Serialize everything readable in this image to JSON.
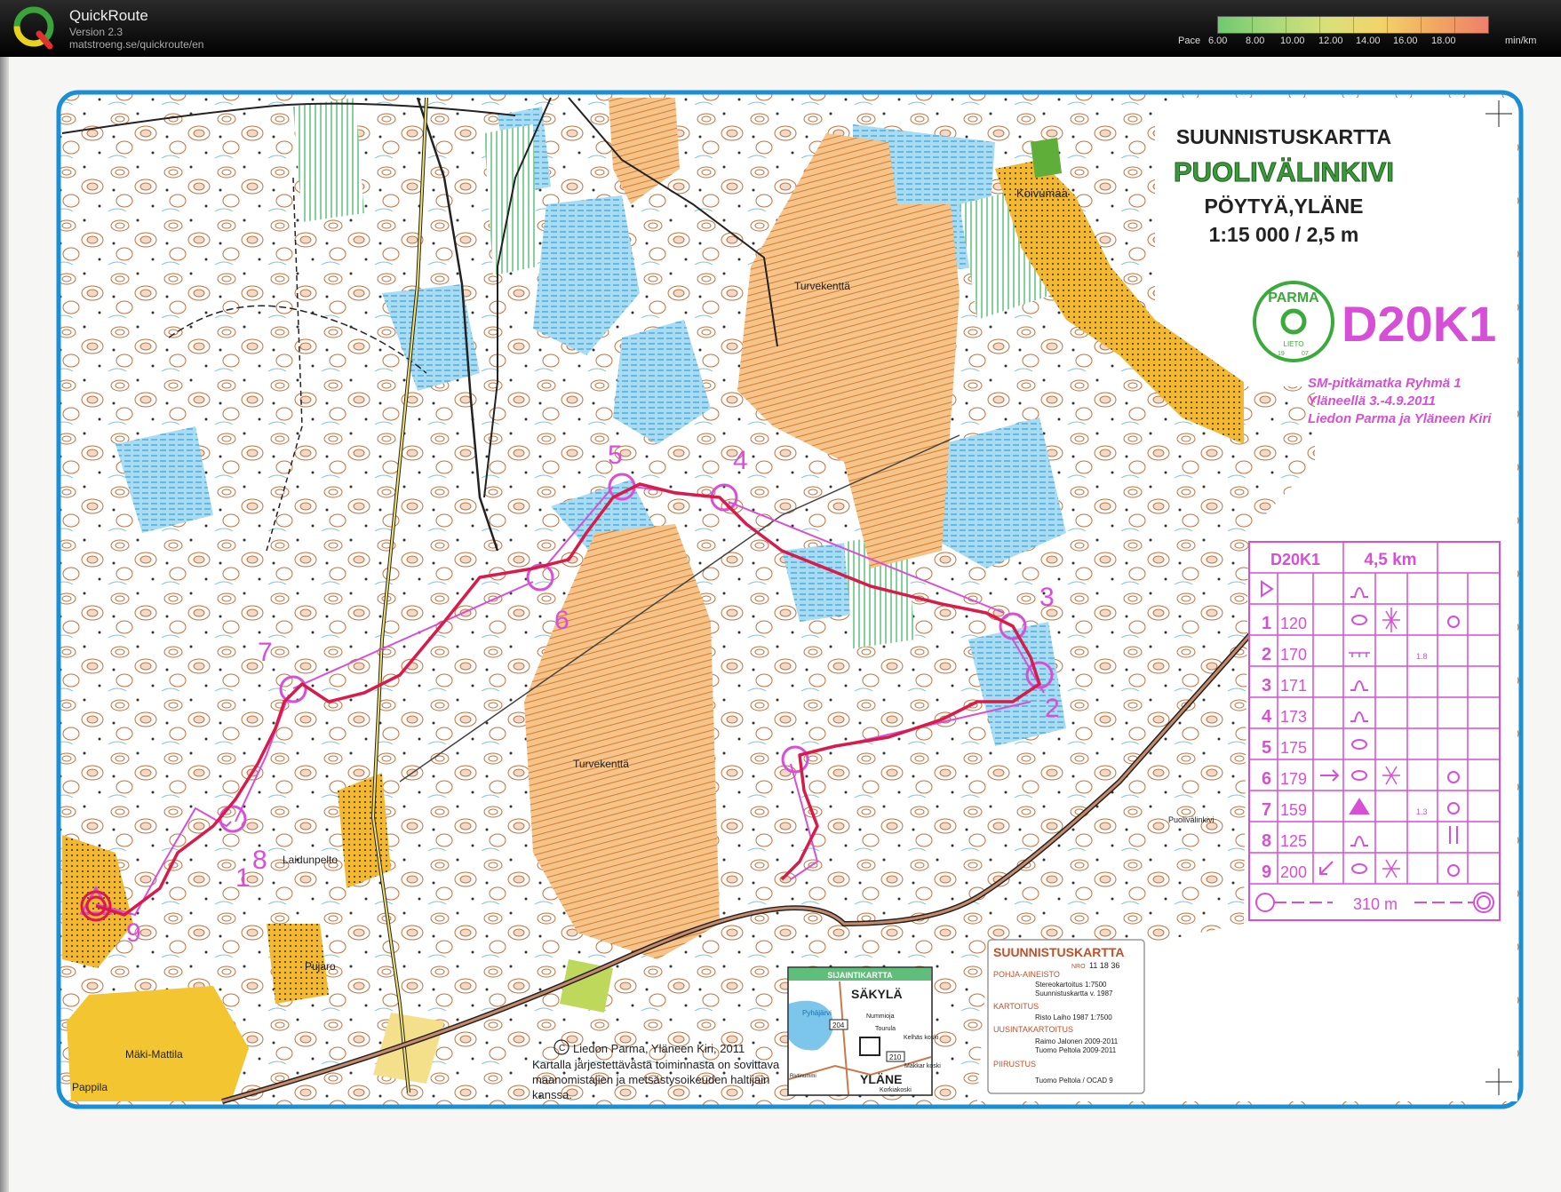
{
  "app": {
    "name": "QuickRoute",
    "version": "Version 2.3",
    "url": "matstroeng.se/quickroute/en",
    "logo_letter": "Q"
  },
  "pace_scale": {
    "label": "Pace",
    "ticks": [
      "6.00",
      "8.00",
      "10.00",
      "12.00",
      "14.00",
      "16.00",
      "18.00"
    ],
    "unit": "min/km"
  },
  "map": {
    "header_title": "SUUNNISTUSKARTTA",
    "name": "PUOLIVÄLINKIVI",
    "location": "PÖYTYÄ,YLÄNE",
    "scale": "1:15 000 / 2,5 m",
    "club_logo": {
      "top": "PARMA",
      "bottom": "LIETO",
      "year_left": "19",
      "year_right": "07"
    },
    "class_code": "D20K1",
    "event_lines": [
      "SM-pitkämatka Ryhmä 1",
      "Yläneellä 3.-4.9.2011",
      "Liedon Parma ja Yläneen Kiri"
    ],
    "place_names": [
      "Koivumaa",
      "Turvekenttä",
      "Turvekenttä",
      "Laidunpelto",
      "Pujaro",
      "Mäki-Mattila",
      "Pappila",
      "Puolivälinkivi"
    ],
    "copyright": [
      "Liedon Parma, Yläneen Kiri,  2011",
      "Kartalla järjestettävästä toiminnasta on sovittava",
      "maanomistajien ja metsästysoikeuden haltijain",
      "kanssa."
    ],
    "control_numbers": [
      "1",
      "2",
      "3",
      "4",
      "5",
      "6",
      "7",
      "8",
      "9"
    ]
  },
  "control_description": {
    "class": "D20K1",
    "length": "4,5 km",
    "rows": [
      {
        "num": "1",
        "code": "120",
        "extra": ""
      },
      {
        "num": "2",
        "code": "170",
        "extra": "1.8"
      },
      {
        "num": "3",
        "code": "171",
        "extra": ""
      },
      {
        "num": "4",
        "code": "173",
        "extra": ""
      },
      {
        "num": "5",
        "code": "175",
        "extra": ""
      },
      {
        "num": "6",
        "code": "179",
        "extra": ""
      },
      {
        "num": "7",
        "code": "159",
        "extra": "1.3"
      },
      {
        "num": "8",
        "code": "125",
        "extra": ""
      },
      {
        "num": "9",
        "code": "200",
        "extra": ""
      }
    ],
    "finish": "310 m"
  },
  "locator": {
    "title": "SIJAINTIKARTTA",
    "towns": [
      "SÄKYLÄ",
      "YLÄNE"
    ],
    "labels": [
      "Pyhäjärvi",
      "Nummioja",
      "Tourula",
      "Kelhäs koski",
      "Makkar koski",
      "Rivtinummi",
      "Korkiakoski"
    ],
    "roads": [
      "204",
      "210"
    ]
  },
  "legend": {
    "title": "SUUNNISTUSKARTTA",
    "nro_label": "NRO",
    "nro": "11 18 36",
    "sections": [
      {
        "heading": "POHJA-AINEISTO",
        "lines": [
          "Stereokartoitus 1:7500",
          "Suunnistuskartta v. 1987"
        ]
      },
      {
        "heading": "KARTOITUS",
        "lines": [
          "Risto Laiho 1987  1:7500"
        ]
      },
      {
        "heading": "UUSINTAKARTOITUS",
        "lines": [
          "Raimo Jalonen 2009-2011",
          "Tuomo Peltola  2009-2011"
        ]
      },
      {
        "heading": "PIIRUSTUS",
        "lines": [
          "Tuomo Peltola / OCAD 9"
        ]
      }
    ]
  },
  "colors": {
    "course": "#d64fd6",
    "route": "#d81b4a",
    "marsh": "#8fd1ec",
    "open": "#f5c77a",
    "field": "#f2c531",
    "contour": "#b8622f",
    "border": "#1a8fd6"
  }
}
